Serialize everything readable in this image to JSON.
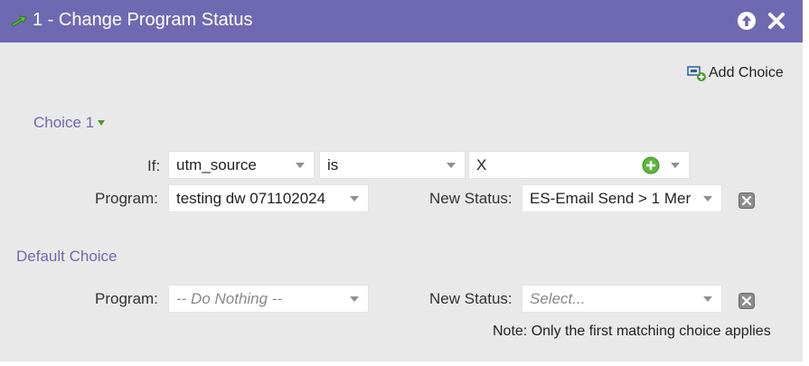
{
  "header": {
    "icon": "green-arrow-icon",
    "title": "1 - Change Program Status",
    "actions": [
      {
        "name": "move-up",
        "icon": "arrow-up-circle-icon"
      },
      {
        "name": "close",
        "icon": "close-x-icon"
      }
    ]
  },
  "toolbar": {
    "add_choice_label": "Add Choice",
    "add_choice_icon": "add-choice-icon"
  },
  "choice1": {
    "title": "Choice 1",
    "if_label": "If:",
    "field": "utm_source",
    "operator": "is",
    "value": "X",
    "program_label": "Program:",
    "program": "testing dw 071102024",
    "new_status_label": "New Status:",
    "new_status": "ES-Email Send > 1 Mer"
  },
  "default_choice": {
    "title": "Default Choice",
    "program_label": "Program:",
    "program_placeholder": "-- Do Nothing --",
    "new_status_label": "New Status:",
    "new_status_placeholder": "Select..."
  },
  "note": "Note: Only the first matching choice applies",
  "colors": {
    "header_bg": "#6f69b2",
    "panel_bg": "#e9e9e9",
    "section_title": "#6f69b2",
    "accent_green": "#4e9a2d"
  }
}
